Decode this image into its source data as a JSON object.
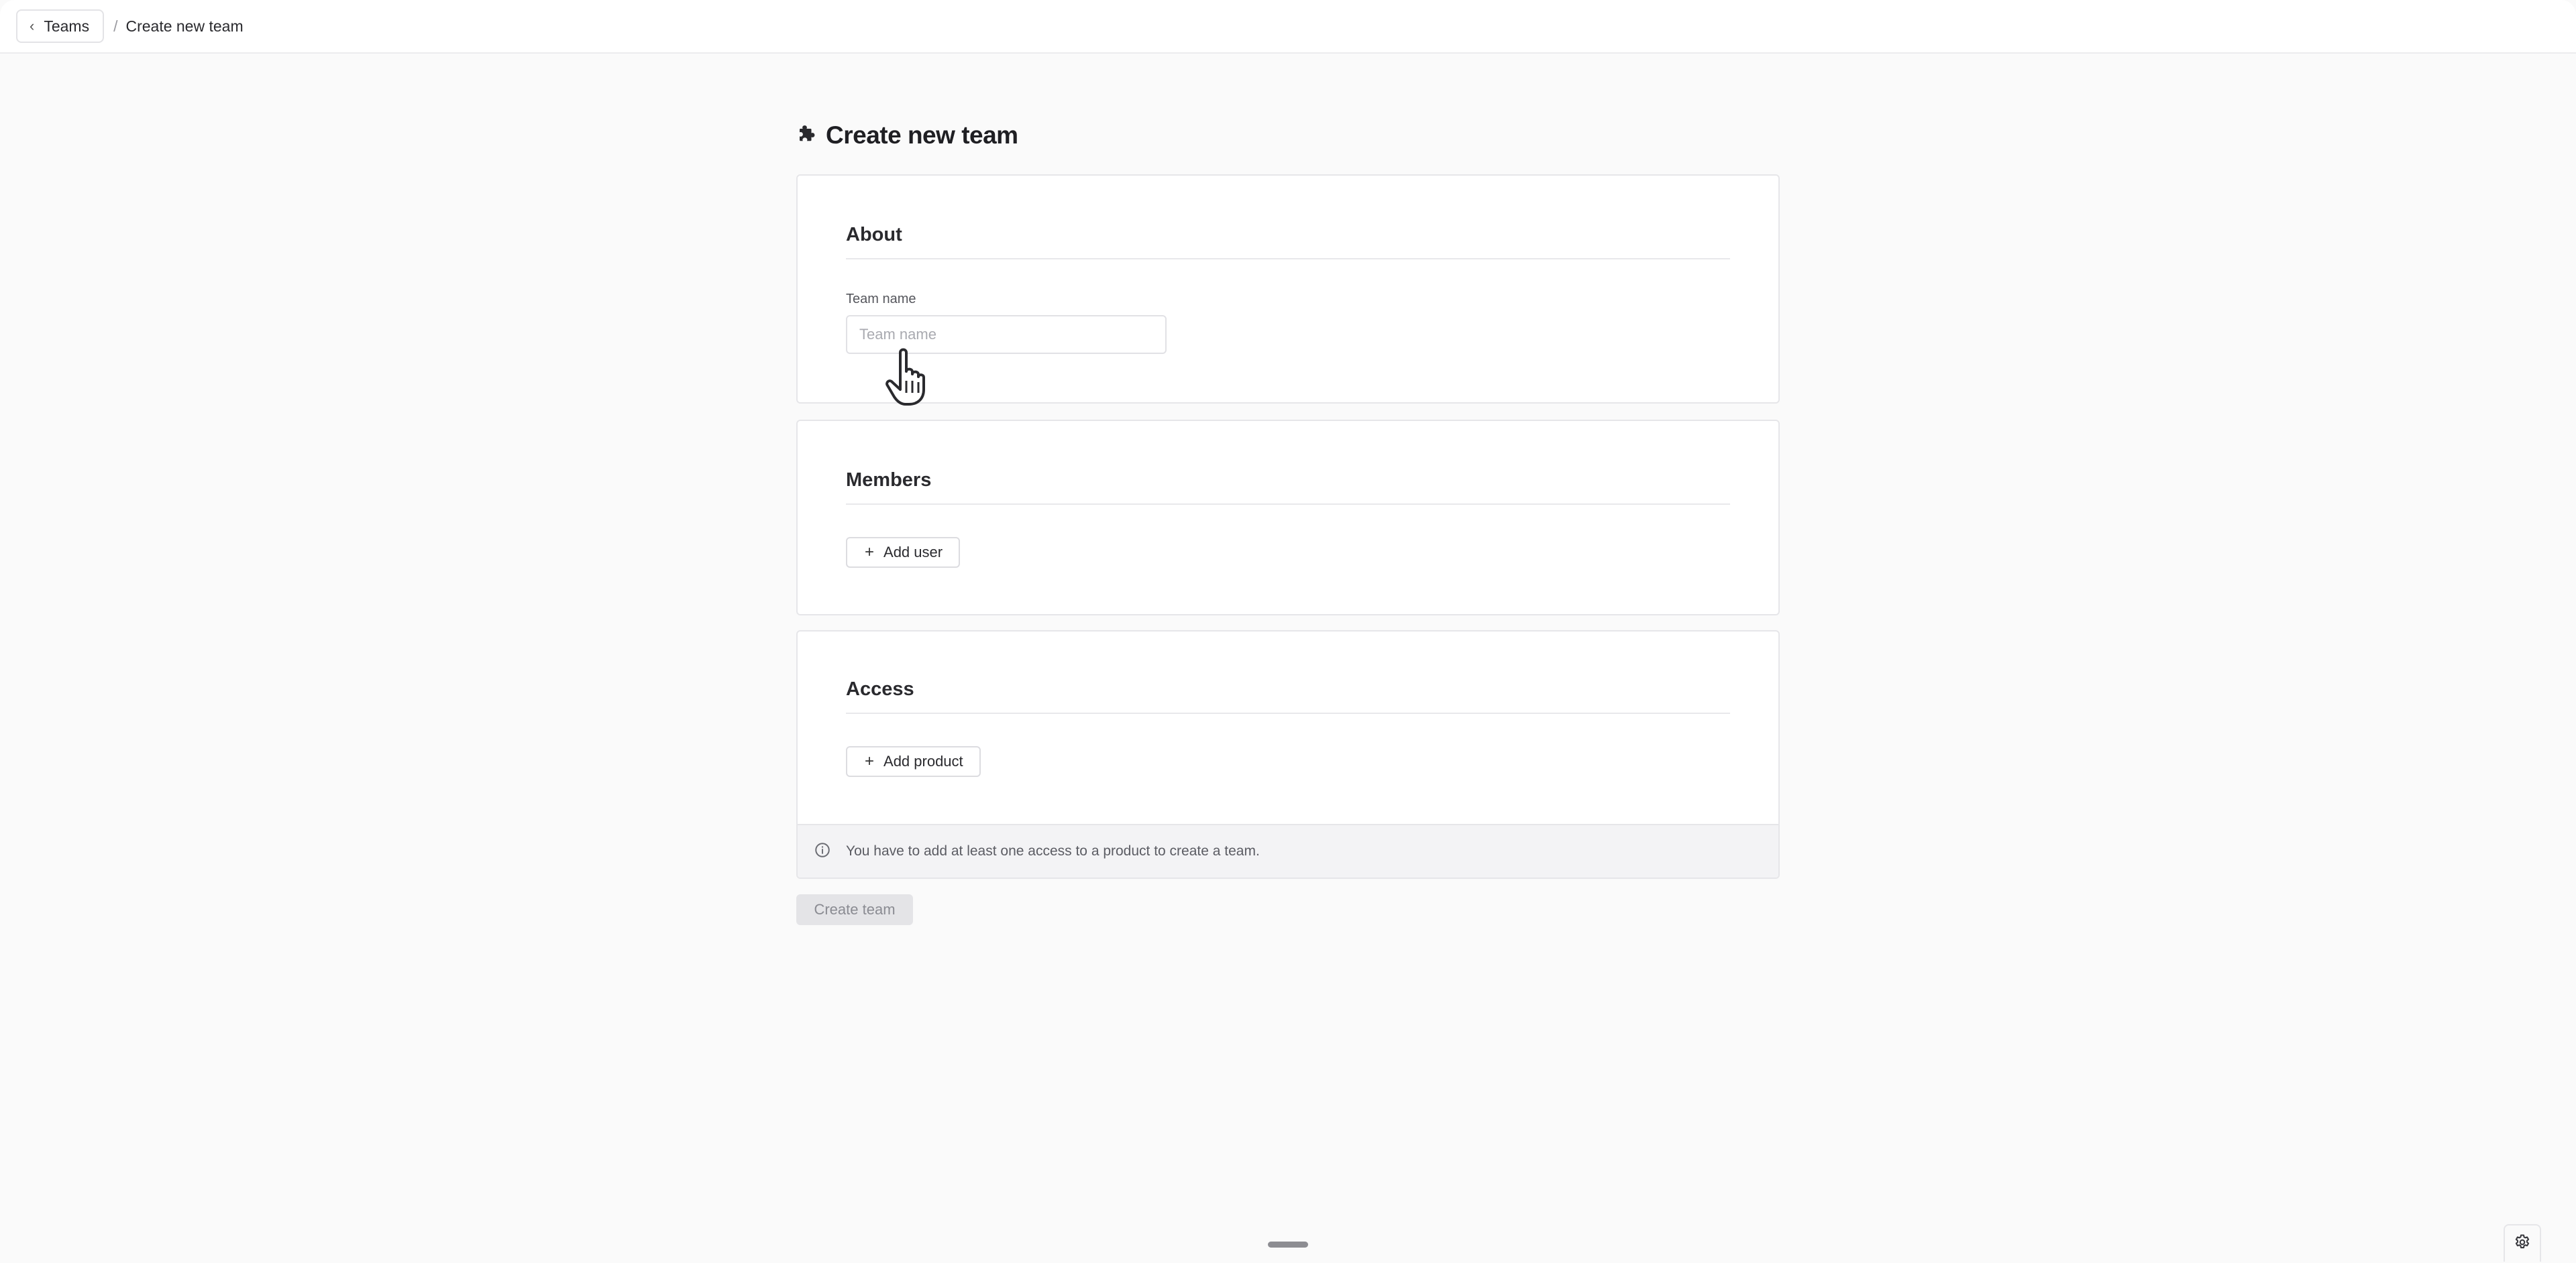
{
  "breadcrumb": {
    "back_label": "Teams",
    "separator": "/",
    "current": "Create new team"
  },
  "page": {
    "title": "Create new team",
    "title_icon": "puzzle-piece-icon"
  },
  "about": {
    "title": "About",
    "team_name_label": "Team name",
    "team_name_placeholder": "Team name",
    "team_name_value": ""
  },
  "members": {
    "title": "Members",
    "add_user_label": "Add user"
  },
  "access": {
    "title": "Access",
    "add_product_label": "Add product",
    "info_icon": "info-circle-icon",
    "info_text": "You have to add at least one access to a product to create a team."
  },
  "actions": {
    "create_team_label": "Create team",
    "create_team_disabled": true
  },
  "footer": {
    "settings_icon": "gear-icon"
  },
  "colors": {
    "page_background": "#fafafa",
    "card_background": "#ffffff",
    "border": "#e6e6e9",
    "disabled_button": "#e4e4e7",
    "text_primary": "#1f1f23"
  }
}
